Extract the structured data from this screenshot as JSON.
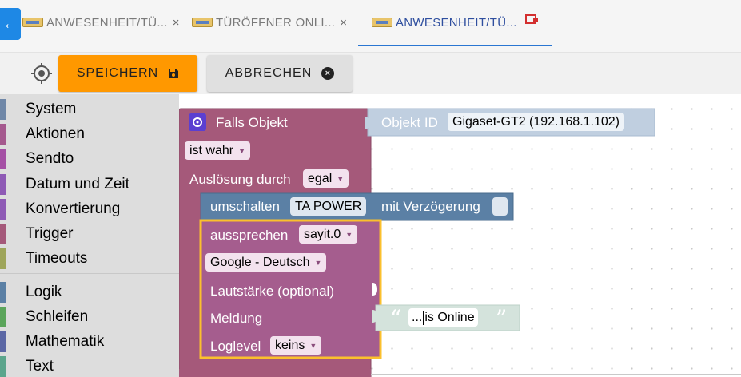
{
  "tabs": [
    {
      "label": "ANWESENHEIT/TÜ...",
      "close": "×"
    },
    {
      "label": "TÜRÖFFNER ONLI...",
      "close": "×"
    },
    {
      "label": "ANWESENHEIT/TÜ...",
      "close": ""
    }
  ],
  "back_icon": "←",
  "toolbar": {
    "save_label": "SPEICHERN",
    "cancel_label": "ABBRECHEN",
    "cancel_icon": "×"
  },
  "categories": [
    {
      "label": "System",
      "color": "#7088a8"
    },
    {
      "label": "Aktionen",
      "color": "#a5598e"
    },
    {
      "label": "Sendto",
      "color": "#a550a5"
    },
    {
      "label": "Datum und Zeit",
      "color": "#8e5ab5"
    },
    {
      "label": "Konvertierung",
      "color": "#8e5ab5"
    },
    {
      "label": "Trigger",
      "color": "#a5597a"
    },
    {
      "label": "Timeouts",
      "color": "#9ea55a"
    },
    {
      "label": "Logik",
      "color": "#5b80a5"
    },
    {
      "label": "Schleifen",
      "color": "#5ba55b"
    },
    {
      "label": "Mathematik",
      "color": "#5b67a5"
    },
    {
      "label": "Text",
      "color": "#5ba58c"
    }
  ],
  "blocks": {
    "trigger": {
      "title": "Falls Objekt",
      "condition": "ist wahr",
      "trigger_label": "Auslösung durch",
      "trigger_value": "egal",
      "object_label": "Objekt ID",
      "object_value": "Gigaset-GT2 (192.168.1.102)"
    },
    "toggle": {
      "label": "umschalten",
      "target": "TA POWER",
      "delay_label": "mit Verzögerung"
    },
    "speak": {
      "label": "aussprechen",
      "instance": "sayit.0",
      "language": "Google - Deutsch",
      "volume_label": "Lautstärke (optional)",
      "message_label": "Meldung",
      "loglevel_label": "Loglevel",
      "loglevel_value": "keins"
    },
    "text": {
      "open_quote": "“",
      "close_quote": "”",
      "prefix": "...",
      "value": " is Online"
    }
  },
  "colors": {
    "accent": "#ff9800",
    "trigger_block": "#a5597a",
    "toggle_block": "#5b80a5",
    "speak_block": "#a55d8e",
    "selection": "#fbc02d"
  }
}
